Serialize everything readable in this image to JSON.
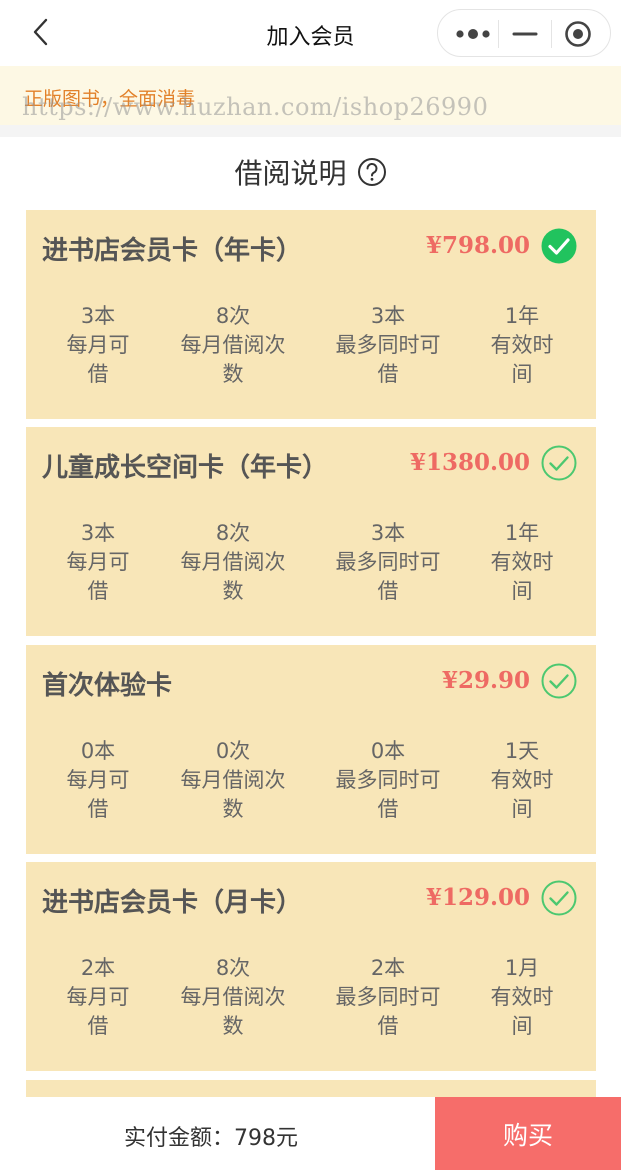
{
  "navbar": {
    "title": "加入会员"
  },
  "notice": {
    "text": "正版图书，全面消毒"
  },
  "watermark": "https://www.huzhan.com/ishop26990",
  "section": {
    "title": "借阅说明"
  },
  "cards": [
    {
      "name": "进书店会员卡（年卡）",
      "price": "¥798.00",
      "selected": true,
      "stats": [
        {
          "value": "3本",
          "label": "每月可借"
        },
        {
          "value": "8次",
          "label": "每月借阅次数"
        },
        {
          "value": "3本",
          "label": "最多同时可借"
        },
        {
          "value": "1年",
          "label": "有效时间"
        }
      ]
    },
    {
      "name": "儿童成长空间卡（年卡）",
      "price": "¥1380.00",
      "selected": false,
      "stats": [
        {
          "value": "3本",
          "label": "每月可借"
        },
        {
          "value": "8次",
          "label": "每月借阅次数"
        },
        {
          "value": "3本",
          "label": "最多同时可借"
        },
        {
          "value": "1年",
          "label": "有效时间"
        }
      ]
    },
    {
      "name": "首次体验卡",
      "price": "¥29.90",
      "selected": false,
      "stats": [
        {
          "value": "0本",
          "label": "每月可借"
        },
        {
          "value": "0次",
          "label": "每月借阅次数"
        },
        {
          "value": "0本",
          "label": "最多同时可借"
        },
        {
          "value": "1天",
          "label": "有效时间"
        }
      ]
    },
    {
      "name": "进书店会员卡（月卡）",
      "price": "¥129.00",
      "selected": false,
      "stats": [
        {
          "value": "2本",
          "label": "每月可借"
        },
        {
          "value": "8次",
          "label": "每月借阅次数"
        },
        {
          "value": "2本",
          "label": "最多同时可借"
        },
        {
          "value": "1月",
          "label": "有效时间"
        }
      ]
    }
  ],
  "footer": {
    "total": "实付金额：798元",
    "buy_label": "购买"
  },
  "colors": {
    "accent": "#f66d6a",
    "price": "#ee6a63",
    "card_bg": "#f8e6b8",
    "check": "#21c35e",
    "notice_text": "#e2812a"
  },
  "icons": [
    "chevron-left-icon",
    "more-dots-icon",
    "minus-icon",
    "target-icon",
    "help-icon",
    "check-circle-icon"
  ]
}
